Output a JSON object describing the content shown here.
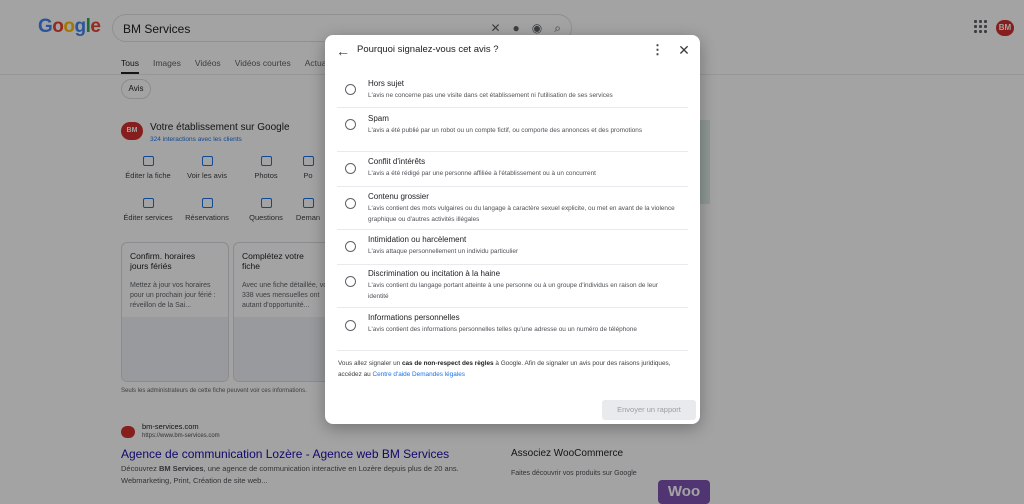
{
  "header": {
    "search_query": "BM Services",
    "account_badge": "BM"
  },
  "tabs": [
    "Tous",
    "Images",
    "Vidéos",
    "Vidéos courtes",
    "Actualités"
  ],
  "filter_chip": "Avis",
  "business": {
    "logo_text": "BM",
    "title": "Votre établissement sur Google",
    "interactions": "324 interactions avec les clients",
    "actions": [
      "Éditer la fiche",
      "Voir les avis",
      "Photos",
      "Po",
      "Éditer services",
      "Réservations",
      "Questions",
      "Deman"
    ],
    "cards": [
      {
        "title": "Confirm. horaires jours fériés",
        "body": "Mettez à jour vos horaires pour un prochain jour férié : réveillon de la Sai..."
      },
      {
        "title": "Complétez votre fiche",
        "body": "Avec une fiche détaillée, vos 338 vues mensuelles ont autant d'opportunité..."
      }
    ],
    "note": "Seuls les administrateurs de cette fiche peuvent voir ces informations."
  },
  "result": {
    "site": "bm-services.com",
    "url": "https://www.bm-services.com",
    "title": "Agence de communication Lozère - Agence web BM Services",
    "desc_bold": "BM Services",
    "desc_pre": "Découvrez ",
    "desc_post": ", une agence de communication interactive en Lozère depuis plus de 20 ans.",
    "desc_line2": "Webmarketing, Print, Création de site web..."
  },
  "right_panel": {
    "woo_title": "Associez WooCommerce",
    "woo_sub": "Faites découvrir vos produits sur Google",
    "woo_logo": "Woo"
  },
  "dialog": {
    "back_icon": "←",
    "title": "Pourquoi signalez-vous cet avis ?",
    "menu_icon": "⋮",
    "close_icon": "✕",
    "options": [
      {
        "title": "Hors sujet",
        "desc": "L'avis ne concerne pas une visite dans cet établissement ni l'utilisation de ses services"
      },
      {
        "title": "Spam",
        "desc": "L'avis a été publié par un robot ou un compte fictif, ou comporte des annonces et des promotions"
      },
      {
        "title": "Conflit d'intérêts",
        "desc": "L'avis a été rédigé par une personne affiliée à l'établissement ou à un concurrent"
      },
      {
        "title": "Contenu grossier",
        "desc": "L'avis contient des mots vulgaires ou du langage à caractère sexuel explicite, ou met en avant de la violence graphique ou d'autres activités illégales"
      },
      {
        "title": "Intimidation ou harcèlement",
        "desc": "L'avis attaque personnellement un individu particulier"
      },
      {
        "title": "Discrimination ou incitation à la haine",
        "desc": "L'avis contient du langage portant atteinte à une personne ou à un groupe d'individus en raison de leur identité"
      },
      {
        "title": "Informations personnelles",
        "desc": "L'avis contient des informations personnelles telles qu'une adresse ou un numéro de téléphone"
      }
    ],
    "footnote_pre": "Vous allez signaler un ",
    "footnote_bold": "cas de non-respect des règles",
    "footnote_mid": " à Google. Afin de signaler un avis pour des raisons juridiques, accédez au ",
    "footnote_link": "Centre d'aide Demandes légales",
    "submit_label": "Envoyer un rapport"
  }
}
